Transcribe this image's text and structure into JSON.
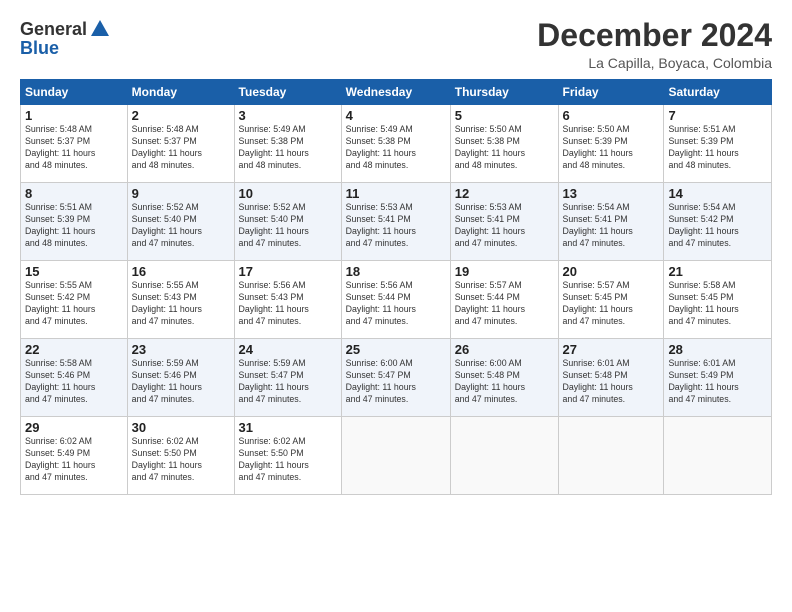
{
  "logo": {
    "line1": "General",
    "line2": "Blue"
  },
  "title": "December 2024",
  "subtitle": "La Capilla, Boyaca, Colombia",
  "header_days": [
    "Sunday",
    "Monday",
    "Tuesday",
    "Wednesday",
    "Thursday",
    "Friday",
    "Saturday"
  ],
  "weeks": [
    [
      {
        "day": "1",
        "info": "Sunrise: 5:48 AM\nSunset: 5:37 PM\nDaylight: 11 hours\nand 48 minutes."
      },
      {
        "day": "2",
        "info": "Sunrise: 5:48 AM\nSunset: 5:37 PM\nDaylight: 11 hours\nand 48 minutes."
      },
      {
        "day": "3",
        "info": "Sunrise: 5:49 AM\nSunset: 5:38 PM\nDaylight: 11 hours\nand 48 minutes."
      },
      {
        "day": "4",
        "info": "Sunrise: 5:49 AM\nSunset: 5:38 PM\nDaylight: 11 hours\nand 48 minutes."
      },
      {
        "day": "5",
        "info": "Sunrise: 5:50 AM\nSunset: 5:38 PM\nDaylight: 11 hours\nand 48 minutes."
      },
      {
        "day": "6",
        "info": "Sunrise: 5:50 AM\nSunset: 5:39 PM\nDaylight: 11 hours\nand 48 minutes."
      },
      {
        "day": "7",
        "info": "Sunrise: 5:51 AM\nSunset: 5:39 PM\nDaylight: 11 hours\nand 48 minutes."
      }
    ],
    [
      {
        "day": "8",
        "info": "Sunrise: 5:51 AM\nSunset: 5:39 PM\nDaylight: 11 hours\nand 48 minutes."
      },
      {
        "day": "9",
        "info": "Sunrise: 5:52 AM\nSunset: 5:40 PM\nDaylight: 11 hours\nand 47 minutes."
      },
      {
        "day": "10",
        "info": "Sunrise: 5:52 AM\nSunset: 5:40 PM\nDaylight: 11 hours\nand 47 minutes."
      },
      {
        "day": "11",
        "info": "Sunrise: 5:53 AM\nSunset: 5:41 PM\nDaylight: 11 hours\nand 47 minutes."
      },
      {
        "day": "12",
        "info": "Sunrise: 5:53 AM\nSunset: 5:41 PM\nDaylight: 11 hours\nand 47 minutes."
      },
      {
        "day": "13",
        "info": "Sunrise: 5:54 AM\nSunset: 5:41 PM\nDaylight: 11 hours\nand 47 minutes."
      },
      {
        "day": "14",
        "info": "Sunrise: 5:54 AM\nSunset: 5:42 PM\nDaylight: 11 hours\nand 47 minutes."
      }
    ],
    [
      {
        "day": "15",
        "info": "Sunrise: 5:55 AM\nSunset: 5:42 PM\nDaylight: 11 hours\nand 47 minutes."
      },
      {
        "day": "16",
        "info": "Sunrise: 5:55 AM\nSunset: 5:43 PM\nDaylight: 11 hours\nand 47 minutes."
      },
      {
        "day": "17",
        "info": "Sunrise: 5:56 AM\nSunset: 5:43 PM\nDaylight: 11 hours\nand 47 minutes."
      },
      {
        "day": "18",
        "info": "Sunrise: 5:56 AM\nSunset: 5:44 PM\nDaylight: 11 hours\nand 47 minutes."
      },
      {
        "day": "19",
        "info": "Sunrise: 5:57 AM\nSunset: 5:44 PM\nDaylight: 11 hours\nand 47 minutes."
      },
      {
        "day": "20",
        "info": "Sunrise: 5:57 AM\nSunset: 5:45 PM\nDaylight: 11 hours\nand 47 minutes."
      },
      {
        "day": "21",
        "info": "Sunrise: 5:58 AM\nSunset: 5:45 PM\nDaylight: 11 hours\nand 47 minutes."
      }
    ],
    [
      {
        "day": "22",
        "info": "Sunrise: 5:58 AM\nSunset: 5:46 PM\nDaylight: 11 hours\nand 47 minutes."
      },
      {
        "day": "23",
        "info": "Sunrise: 5:59 AM\nSunset: 5:46 PM\nDaylight: 11 hours\nand 47 minutes."
      },
      {
        "day": "24",
        "info": "Sunrise: 5:59 AM\nSunset: 5:47 PM\nDaylight: 11 hours\nand 47 minutes."
      },
      {
        "day": "25",
        "info": "Sunrise: 6:00 AM\nSunset: 5:47 PM\nDaylight: 11 hours\nand 47 minutes."
      },
      {
        "day": "26",
        "info": "Sunrise: 6:00 AM\nSunset: 5:48 PM\nDaylight: 11 hours\nand 47 minutes."
      },
      {
        "day": "27",
        "info": "Sunrise: 6:01 AM\nSunset: 5:48 PM\nDaylight: 11 hours\nand 47 minutes."
      },
      {
        "day": "28",
        "info": "Sunrise: 6:01 AM\nSunset: 5:49 PM\nDaylight: 11 hours\nand 47 minutes."
      }
    ],
    [
      {
        "day": "29",
        "info": "Sunrise: 6:02 AM\nSunset: 5:49 PM\nDaylight: 11 hours\nand 47 minutes."
      },
      {
        "day": "30",
        "info": "Sunrise: 6:02 AM\nSunset: 5:50 PM\nDaylight: 11 hours\nand 47 minutes."
      },
      {
        "day": "31",
        "info": "Sunrise: 6:02 AM\nSunset: 5:50 PM\nDaylight: 11 hours\nand 47 minutes."
      },
      null,
      null,
      null,
      null
    ]
  ]
}
